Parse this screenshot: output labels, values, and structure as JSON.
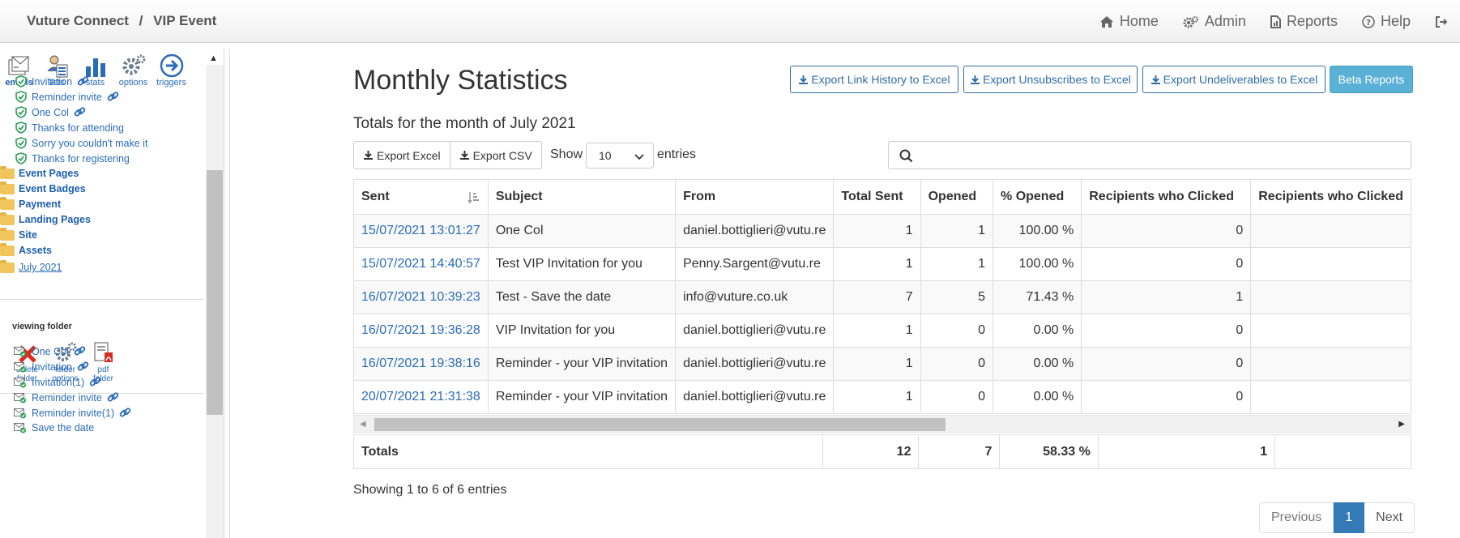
{
  "header": {
    "app_name": "Vuture Connect",
    "separator": "/",
    "section": "VIP Event",
    "nav": [
      {
        "label": "Home",
        "icon": "home-icon"
      },
      {
        "label": "Admin",
        "icon": "gears-icon"
      },
      {
        "label": "Reports",
        "icon": "report-icon"
      },
      {
        "label": "Help",
        "icon": "help-icon"
      }
    ],
    "logout_icon": "logout-icon"
  },
  "sidebar": {
    "toolbar": [
      {
        "label": "emails",
        "icon": "emails-icon",
        "active": true
      },
      {
        "label": "lists",
        "icon": "lists-icon"
      },
      {
        "label": "stats",
        "icon": "stats-icon"
      },
      {
        "label": "options",
        "icon": "options-gear-icon"
      },
      {
        "label": "triggers",
        "icon": "triggers-arrow-icon"
      }
    ],
    "approved_emails": [
      "Invitation",
      "Reminder invite",
      "One Col",
      "Thanks for attending",
      "Sorry you couldn't make it",
      "Thanks for registering"
    ],
    "folders": [
      "Event Pages",
      "Event Badges",
      "Payment",
      "Landing Pages",
      "Site",
      "Assets"
    ],
    "current_folder": "July 2021",
    "viewing_label": "viewing  folder",
    "folder_tools": [
      {
        "line1": "delete",
        "line2": "folder",
        "icon": "delete-x-icon"
      },
      {
        "line1": "folder",
        "line2": "options",
        "icon": "folder-gear-icon"
      },
      {
        "line1": "pdf",
        "line2": "folder",
        "icon": "pdf-icon"
      }
    ],
    "folder_emails": [
      "One Col",
      "Invitation",
      "Invitation(1)",
      "Reminder invite",
      "Reminder invite(1)",
      "Save the date"
    ]
  },
  "main": {
    "title": "Monthly Statistics",
    "subtitle": "Totals for the month of July 2021",
    "export_buttons": [
      "Export Link History to Excel",
      "Export Unsubscribes to Excel",
      "Export Undeliverables to Excel"
    ],
    "beta_button": "Beta Reports",
    "export_excel": "Export Excel",
    "export_csv": "Export CSV",
    "show_label": "Show",
    "show_value": "10",
    "entries_label": "entries",
    "search_value": "",
    "columns": [
      "Sent",
      "Subject",
      "From",
      "Total Sent",
      "Opened",
      "% Opened",
      "Recipients who Clicked",
      "Recipients who Clicked"
    ],
    "rows": [
      {
        "sent": "15/07/2021 13:01:27",
        "subject": "One Col",
        "from": "daniel.bottiglieri@vutu.re",
        "total": "1",
        "opened": "1",
        "pct": "100.00 %",
        "clicked": "0"
      },
      {
        "sent": "15/07/2021 14:40:57",
        "subject": "Test VIP Invitation for you",
        "from": "Penny.Sargent@vutu.re",
        "total": "1",
        "opened": "1",
        "pct": "100.00 %",
        "clicked": "0"
      },
      {
        "sent": "16/07/2021 10:39:23",
        "subject": "Test - Save the date",
        "from": "info@vuture.co.uk",
        "total": "7",
        "opened": "5",
        "pct": "71.43 %",
        "clicked": "1"
      },
      {
        "sent": "16/07/2021 19:36:28",
        "subject": "VIP Invitation for you",
        "from": "daniel.bottiglieri@vutu.re",
        "total": "1",
        "opened": "0",
        "pct": "0.00 %",
        "clicked": "0"
      },
      {
        "sent": "16/07/2021 19:38:16",
        "subject": "Reminder - your VIP invitation",
        "from": "daniel.bottiglieri@vutu.re",
        "total": "1",
        "opened": "0",
        "pct": "0.00 %",
        "clicked": "0"
      },
      {
        "sent": "20/07/2021 21:31:38",
        "subject": "Reminder - your VIP invitation",
        "from": "daniel.bottiglieri@vutu.re",
        "total": "1",
        "opened": "0",
        "pct": "0.00 %",
        "clicked": "0"
      }
    ],
    "totals": {
      "label": "Totals",
      "total": "12",
      "opened": "7",
      "pct": "58.33 %",
      "clicked": "1"
    },
    "info": "Showing 1 to 6 of 6 entries",
    "pager": {
      "previous": "Previous",
      "current": "1",
      "next": "Next"
    }
  },
  "colors": {
    "link": "#2a6cb8",
    "beta_button": "#5bb0d6",
    "pager_active": "#337ab7",
    "folder": "#f2c55c"
  }
}
